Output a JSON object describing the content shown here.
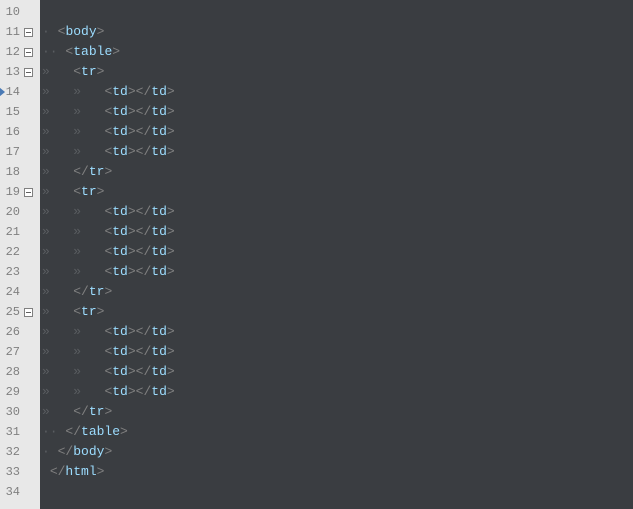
{
  "lines": [
    {
      "num": "10",
      "fold": null,
      "bookmark": false,
      "segments": []
    },
    {
      "num": "11",
      "fold": "open",
      "bookmark": false,
      "segments": [
        {
          "t": "ws",
          "v": "·"
        },
        {
          "t": "sp",
          "v": " "
        },
        {
          "t": "br",
          "v": "<"
        },
        {
          "t": "tag",
          "v": "body"
        },
        {
          "t": "br",
          "v": ">"
        }
      ]
    },
    {
      "num": "12",
      "fold": "open",
      "bookmark": false,
      "segments": [
        {
          "t": "ws",
          "v": "··"
        },
        {
          "t": "sp",
          "v": " "
        },
        {
          "t": "br",
          "v": "<"
        },
        {
          "t": "tag",
          "v": "table"
        },
        {
          "t": "br",
          "v": ">"
        }
      ]
    },
    {
      "num": "13",
      "fold": "open",
      "bookmark": false,
      "segments": [
        {
          "t": "ws",
          "v": "»"
        },
        {
          "t": "sp",
          "v": "   "
        },
        {
          "t": "br",
          "v": "<"
        },
        {
          "t": "tag",
          "v": "tr"
        },
        {
          "t": "br",
          "v": ">"
        }
      ]
    },
    {
      "num": "14",
      "fold": null,
      "bookmark": true,
      "segments": [
        {
          "t": "ws",
          "v": "»"
        },
        {
          "t": "sp",
          "v": "   "
        },
        {
          "t": "ws",
          "v": "»"
        },
        {
          "t": "sp",
          "v": "   "
        },
        {
          "t": "br",
          "v": "<"
        },
        {
          "t": "tag",
          "v": "td"
        },
        {
          "t": "br",
          "v": "></"
        },
        {
          "t": "tag",
          "v": "td"
        },
        {
          "t": "br",
          "v": ">"
        }
      ]
    },
    {
      "num": "15",
      "fold": null,
      "bookmark": false,
      "segments": [
        {
          "t": "ws",
          "v": "»"
        },
        {
          "t": "sp",
          "v": "   "
        },
        {
          "t": "ws",
          "v": "»"
        },
        {
          "t": "sp",
          "v": "   "
        },
        {
          "t": "br",
          "v": "<"
        },
        {
          "t": "tag",
          "v": "td"
        },
        {
          "t": "br",
          "v": "></"
        },
        {
          "t": "tag",
          "v": "td"
        },
        {
          "t": "br",
          "v": ">"
        }
      ]
    },
    {
      "num": "16",
      "fold": null,
      "bookmark": false,
      "segments": [
        {
          "t": "ws",
          "v": "»"
        },
        {
          "t": "sp",
          "v": "   "
        },
        {
          "t": "ws",
          "v": "»"
        },
        {
          "t": "sp",
          "v": "   "
        },
        {
          "t": "br",
          "v": "<"
        },
        {
          "t": "tag",
          "v": "td"
        },
        {
          "t": "br",
          "v": "></"
        },
        {
          "t": "tag",
          "v": "td"
        },
        {
          "t": "br",
          "v": ">"
        }
      ]
    },
    {
      "num": "17",
      "fold": null,
      "bookmark": false,
      "segments": [
        {
          "t": "ws",
          "v": "»"
        },
        {
          "t": "sp",
          "v": "   "
        },
        {
          "t": "ws",
          "v": "»"
        },
        {
          "t": "sp",
          "v": "   "
        },
        {
          "t": "br",
          "v": "<"
        },
        {
          "t": "tag",
          "v": "td"
        },
        {
          "t": "br",
          "v": "></"
        },
        {
          "t": "tag",
          "v": "td"
        },
        {
          "t": "br",
          "v": ">"
        }
      ]
    },
    {
      "num": "18",
      "fold": null,
      "bookmark": false,
      "segments": [
        {
          "t": "ws",
          "v": "»"
        },
        {
          "t": "sp",
          "v": "   "
        },
        {
          "t": "br",
          "v": "</"
        },
        {
          "t": "tag",
          "v": "tr"
        },
        {
          "t": "br",
          "v": ">"
        }
      ]
    },
    {
      "num": "19",
      "fold": "open",
      "bookmark": false,
      "segments": [
        {
          "t": "ws",
          "v": "»"
        },
        {
          "t": "sp",
          "v": "   "
        },
        {
          "t": "br",
          "v": "<"
        },
        {
          "t": "tag",
          "v": "tr"
        },
        {
          "t": "br",
          "v": ">"
        }
      ]
    },
    {
      "num": "20",
      "fold": null,
      "bookmark": false,
      "segments": [
        {
          "t": "ws",
          "v": "»"
        },
        {
          "t": "sp",
          "v": "   "
        },
        {
          "t": "ws",
          "v": "»"
        },
        {
          "t": "sp",
          "v": "   "
        },
        {
          "t": "br",
          "v": "<"
        },
        {
          "t": "tag",
          "v": "td"
        },
        {
          "t": "br",
          "v": "></"
        },
        {
          "t": "tag",
          "v": "td"
        },
        {
          "t": "br",
          "v": ">"
        }
      ]
    },
    {
      "num": "21",
      "fold": null,
      "bookmark": false,
      "segments": [
        {
          "t": "ws",
          "v": "»"
        },
        {
          "t": "sp",
          "v": "   "
        },
        {
          "t": "ws",
          "v": "»"
        },
        {
          "t": "sp",
          "v": "   "
        },
        {
          "t": "br",
          "v": "<"
        },
        {
          "t": "tag",
          "v": "td"
        },
        {
          "t": "br",
          "v": "></"
        },
        {
          "t": "tag",
          "v": "td"
        },
        {
          "t": "br",
          "v": ">"
        }
      ]
    },
    {
      "num": "22",
      "fold": null,
      "bookmark": false,
      "segments": [
        {
          "t": "ws",
          "v": "»"
        },
        {
          "t": "sp",
          "v": "   "
        },
        {
          "t": "ws",
          "v": "»"
        },
        {
          "t": "sp",
          "v": "   "
        },
        {
          "t": "br",
          "v": "<"
        },
        {
          "t": "tag",
          "v": "td"
        },
        {
          "t": "br",
          "v": "></"
        },
        {
          "t": "tag",
          "v": "td"
        },
        {
          "t": "br",
          "v": ">"
        }
      ]
    },
    {
      "num": "23",
      "fold": null,
      "bookmark": false,
      "segments": [
        {
          "t": "ws",
          "v": "»"
        },
        {
          "t": "sp",
          "v": "   "
        },
        {
          "t": "ws",
          "v": "»"
        },
        {
          "t": "sp",
          "v": "   "
        },
        {
          "t": "br",
          "v": "<"
        },
        {
          "t": "tag",
          "v": "td"
        },
        {
          "t": "br",
          "v": "></"
        },
        {
          "t": "tag",
          "v": "td"
        },
        {
          "t": "br",
          "v": ">"
        }
      ]
    },
    {
      "num": "24",
      "fold": null,
      "bookmark": false,
      "segments": [
        {
          "t": "ws",
          "v": "»"
        },
        {
          "t": "sp",
          "v": "   "
        },
        {
          "t": "br",
          "v": "</"
        },
        {
          "t": "tag",
          "v": "tr"
        },
        {
          "t": "br",
          "v": ">"
        }
      ]
    },
    {
      "num": "25",
      "fold": "open",
      "bookmark": false,
      "segments": [
        {
          "t": "ws",
          "v": "»"
        },
        {
          "t": "sp",
          "v": "   "
        },
        {
          "t": "br",
          "v": "<"
        },
        {
          "t": "tag",
          "v": "tr"
        },
        {
          "t": "br",
          "v": ">"
        }
      ]
    },
    {
      "num": "26",
      "fold": null,
      "bookmark": false,
      "segments": [
        {
          "t": "ws",
          "v": "»"
        },
        {
          "t": "sp",
          "v": "   "
        },
        {
          "t": "ws",
          "v": "»"
        },
        {
          "t": "sp",
          "v": "   "
        },
        {
          "t": "br",
          "v": "<"
        },
        {
          "t": "tag",
          "v": "td"
        },
        {
          "t": "br",
          "v": "></"
        },
        {
          "t": "tag",
          "v": "td"
        },
        {
          "t": "br",
          "v": ">"
        }
      ]
    },
    {
      "num": "27",
      "fold": null,
      "bookmark": false,
      "segments": [
        {
          "t": "ws",
          "v": "»"
        },
        {
          "t": "sp",
          "v": "   "
        },
        {
          "t": "ws",
          "v": "»"
        },
        {
          "t": "sp",
          "v": "   "
        },
        {
          "t": "br",
          "v": "<"
        },
        {
          "t": "tag",
          "v": "td"
        },
        {
          "t": "br",
          "v": "></"
        },
        {
          "t": "tag",
          "v": "td"
        },
        {
          "t": "br",
          "v": ">"
        }
      ]
    },
    {
      "num": "28",
      "fold": null,
      "bookmark": false,
      "segments": [
        {
          "t": "ws",
          "v": "»"
        },
        {
          "t": "sp",
          "v": "   "
        },
        {
          "t": "ws",
          "v": "»"
        },
        {
          "t": "sp",
          "v": "   "
        },
        {
          "t": "br",
          "v": "<"
        },
        {
          "t": "tag",
          "v": "td"
        },
        {
          "t": "br",
          "v": "></"
        },
        {
          "t": "tag",
          "v": "td"
        },
        {
          "t": "br",
          "v": ">"
        }
      ]
    },
    {
      "num": "29",
      "fold": null,
      "bookmark": false,
      "segments": [
        {
          "t": "ws",
          "v": "»"
        },
        {
          "t": "sp",
          "v": "   "
        },
        {
          "t": "ws",
          "v": "»"
        },
        {
          "t": "sp",
          "v": "   "
        },
        {
          "t": "br",
          "v": "<"
        },
        {
          "t": "tag",
          "v": "td"
        },
        {
          "t": "br",
          "v": "></"
        },
        {
          "t": "tag",
          "v": "td"
        },
        {
          "t": "br",
          "v": ">"
        }
      ]
    },
    {
      "num": "30",
      "fold": null,
      "bookmark": false,
      "segments": [
        {
          "t": "ws",
          "v": "»"
        },
        {
          "t": "sp",
          "v": "   "
        },
        {
          "t": "br",
          "v": "</"
        },
        {
          "t": "tag",
          "v": "tr"
        },
        {
          "t": "br",
          "v": ">"
        }
      ]
    },
    {
      "num": "31",
      "fold": null,
      "bookmark": false,
      "segments": [
        {
          "t": "ws",
          "v": "··"
        },
        {
          "t": "sp",
          "v": " "
        },
        {
          "t": "br",
          "v": "</"
        },
        {
          "t": "tag",
          "v": "table"
        },
        {
          "t": "br",
          "v": ">"
        }
      ]
    },
    {
      "num": "32",
      "fold": null,
      "bookmark": false,
      "segments": [
        {
          "t": "ws",
          "v": "·"
        },
        {
          "t": "sp",
          "v": " "
        },
        {
          "t": "br",
          "v": "</"
        },
        {
          "t": "tag",
          "v": "body"
        },
        {
          "t": "br",
          "v": ">"
        }
      ]
    },
    {
      "num": "33",
      "fold": null,
      "bookmark": false,
      "segments": [
        {
          "t": "sp",
          "v": " "
        },
        {
          "t": "br",
          "v": "</"
        },
        {
          "t": "tag",
          "v": "html"
        },
        {
          "t": "br",
          "v": ">"
        }
      ]
    },
    {
      "num": "34",
      "fold": null,
      "bookmark": false,
      "segments": []
    }
  ]
}
